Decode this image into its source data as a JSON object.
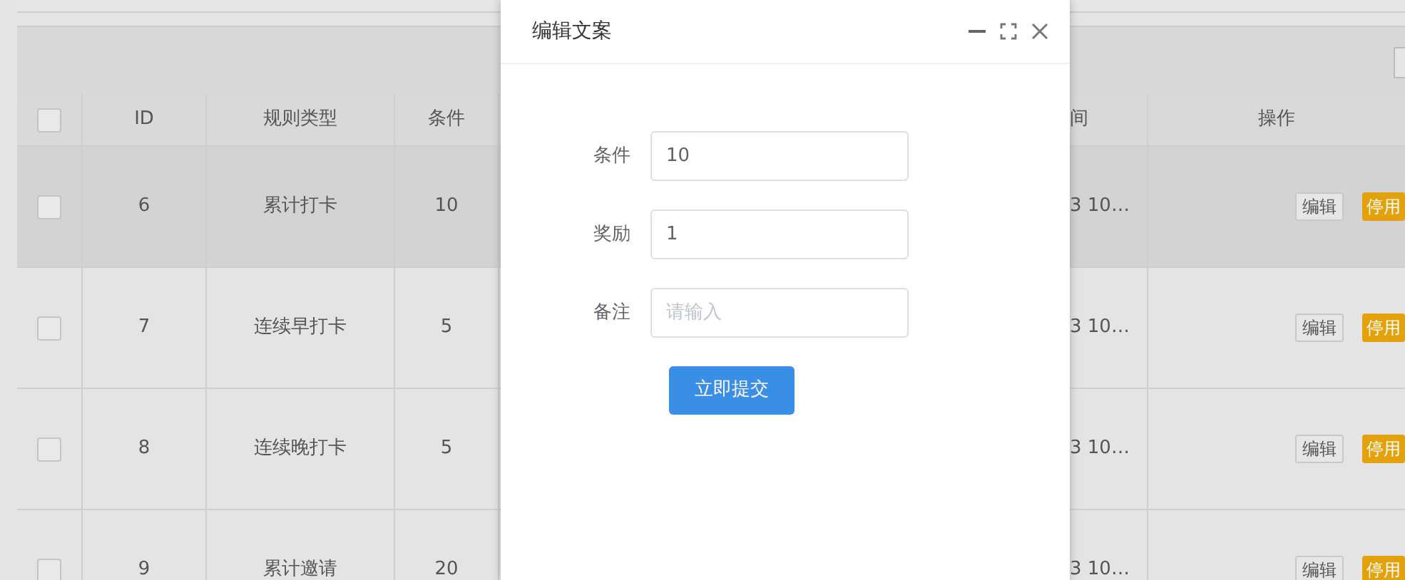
{
  "table": {
    "columns": [
      {
        "kind": "checkbox",
        "checked": false
      },
      {
        "kind": "text",
        "label": "ID"
      },
      {
        "kind": "text",
        "label": "规则类型"
      },
      {
        "kind": "text",
        "label": "条件"
      },
      {
        "kind": "gap"
      },
      {
        "kind": "text",
        "label": "间"
      },
      {
        "kind": "text",
        "label": "操作"
      }
    ],
    "rows": [
      {
        "checked": false,
        "hovered": true,
        "id": "6",
        "type": "累计打卡",
        "condition": "10",
        "time": "3 10…",
        "actions": [
          "编辑",
          "停用"
        ]
      },
      {
        "checked": false,
        "hovered": false,
        "id": "7",
        "type": "连续早打卡",
        "condition": "5",
        "time": "3 10…",
        "actions": [
          "编辑",
          "停用"
        ]
      },
      {
        "checked": false,
        "hovered": false,
        "id": "8",
        "type": "连续晚打卡",
        "condition": "5",
        "time": "3 10…",
        "actions": [
          "编辑",
          "停用"
        ]
      },
      {
        "checked": false,
        "hovered": false,
        "id": "9",
        "type": "累计邀请",
        "condition": "20",
        "time": "3 10…",
        "actions": [
          "编辑",
          "停用"
        ]
      }
    ]
  },
  "dialog": {
    "title": "编辑文案",
    "fields": [
      {
        "label": "条件",
        "value": "10"
      },
      {
        "label": "奖励",
        "value": "1"
      },
      {
        "label": "备注",
        "placeholder": "请输入"
      }
    ],
    "submit": "立即提交"
  }
}
